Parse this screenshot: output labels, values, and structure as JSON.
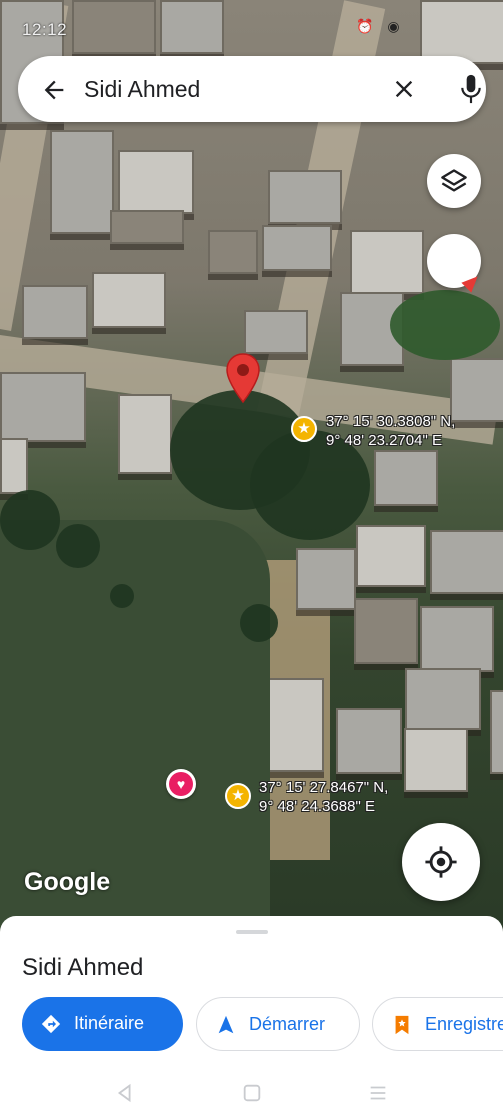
{
  "status_bar": {
    "time": "12:12"
  },
  "search": {
    "query": "Sidi Ahmed"
  },
  "map": {
    "markers": [
      {
        "lat": "37° 15' 30.3808\" N,",
        "lon": "9° 48' 23.2704\" E"
      },
      {
        "lat": "37° 15' 27.8467\" N,",
        "lon": "9° 48' 24.3688\" E"
      }
    ],
    "attribution": "Google"
  },
  "sheet": {
    "title": "Sidi Ahmed",
    "actions": [
      {
        "label": "Itinéraire",
        "icon": "directions-icon"
      },
      {
        "label": "Démarrer",
        "icon": "navigation-arrow-icon"
      },
      {
        "label": "Enregistrer",
        "icon": "bookmark-icon"
      }
    ]
  },
  "colors": {
    "accent": "#1a73e8",
    "pin_red": "#e53935",
    "star": "#f4b400",
    "heart": "#e91e63"
  },
  "icons": [
    "back-arrow-icon",
    "clear-icon",
    "mic-icon",
    "layers-icon",
    "compass-icon",
    "my-location-icon",
    "nav-back-icon",
    "nav-home-icon",
    "nav-recents-icon"
  ]
}
